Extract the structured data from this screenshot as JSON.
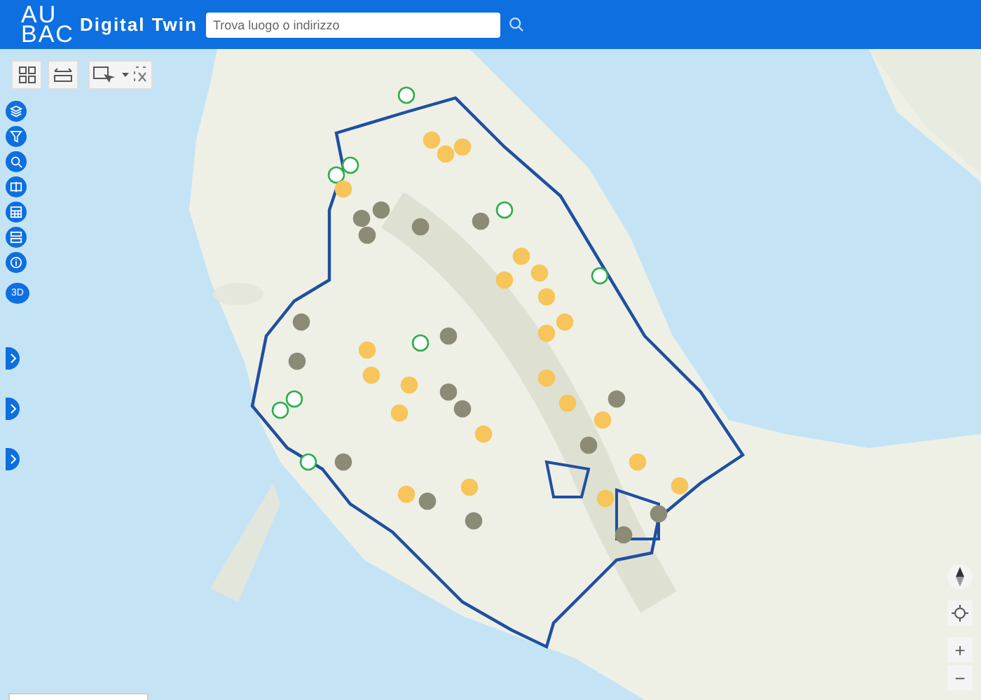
{
  "header": {
    "logo_top": "AU",
    "logo_bottom": "BAC",
    "title": "Digital Twin",
    "search": {
      "placeholder": "Trova luogo o indirizzo"
    }
  },
  "map_toolbar": [
    {
      "kind": "grid"
    },
    {
      "kind": "measure"
    },
    {
      "kind": "select"
    }
  ],
  "side_tools": [
    {
      "kind": "layers"
    },
    {
      "kind": "filter"
    },
    {
      "kind": "zoom-search"
    },
    {
      "kind": "compare"
    },
    {
      "kind": "table"
    },
    {
      "kind": "form"
    },
    {
      "kind": "info"
    },
    {
      "kind": "text",
      "label": "3D"
    }
  ],
  "side_panels": [
    {
      "expanded": false
    },
    {
      "expanded": false
    },
    {
      "expanded": false
    }
  ],
  "map_controls": {
    "zoom_in": "+",
    "zoom_out": "−"
  }
}
